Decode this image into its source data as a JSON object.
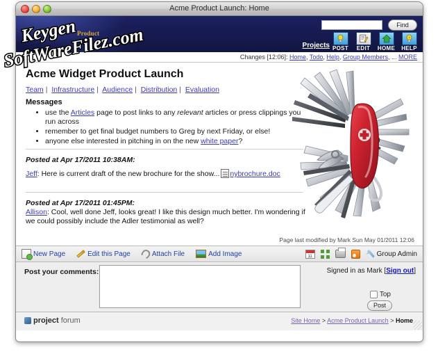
{
  "window": {
    "title": "Acme Product Launch: Home",
    "buttons": {
      "close": "close",
      "minimize": "minimize",
      "zoom": "zoom"
    }
  },
  "watermark": {
    "line1": "Keygen",
    "line2": "SoftWareFilez.com"
  },
  "header": {
    "logo_word": "Product",
    "search_value": "",
    "search_placeholder": "",
    "find_label": "Find",
    "projects_label": "Projects",
    "icons": [
      {
        "name": "post-icon",
        "label": "POST",
        "glyph": "⚈"
      },
      {
        "name": "edit-icon",
        "label": "EDIT",
        "glyph": "✎"
      },
      {
        "name": "home-icon",
        "label": "HOME",
        "glyph": "⌂"
      },
      {
        "name": "help-icon",
        "label": "HELP",
        "glyph": "?"
      }
    ]
  },
  "changes": {
    "prefix": "Changes [12:06]:",
    "links": [
      "Home",
      "Todo",
      "Help",
      "Group Members"
    ],
    "ellipsis": "...",
    "more": "MORE"
  },
  "page": {
    "title": "Acme Widget Product Launch",
    "nav": [
      "Team",
      "Infrastructure",
      "Audience",
      "Distribution",
      "Evaluation"
    ],
    "messages_heading": "Messages",
    "messages": [
      {
        "pre": "use the ",
        "link": "Articles",
        "mid": " page to post links to any ",
        "em": "relevant",
        "post": " articles or press clippings you run across"
      },
      {
        "pre": "remember to get final budget numbers to Greg by next Friday, or else!",
        "link": "",
        "mid": "",
        "em": "",
        "post": ""
      },
      {
        "pre": "anyone else interested in pitching in on the new ",
        "link": "white paper",
        "mid": "?",
        "em": "",
        "post": ""
      }
    ],
    "posts": [
      {
        "when": "Posted at Apr 17/2011 10:38AM:",
        "user": "Jeff",
        "text": ": Here is current draft of the new brochure for the show...",
        "attachment": "nybrochure.doc"
      },
      {
        "when": "Posted at Apr 17/2011 01:45PM:",
        "user": "Allison",
        "text": ": Cool, well done Jeff, looks great! I like this design much better. I'm wondering if we could possibly include the Adler testimonial as well?",
        "attachment": ""
      }
    ],
    "last_modified": "Page last modified by Mark Sun May 01/2011 12:06"
  },
  "toolbar": {
    "items": [
      {
        "name": "new-page",
        "label": "New Page"
      },
      {
        "name": "edit-this-page",
        "label": "Edit this Page"
      },
      {
        "name": "attach-file",
        "label": "Attach File"
      },
      {
        "name": "add-image",
        "label": "Add Image"
      }
    ],
    "right_icons": [
      "calendar-icon",
      "sitemap-icon",
      "print-icon",
      "rss-icon",
      "wrench-icon"
    ],
    "group_admin_label": "Group Admin"
  },
  "comments": {
    "label": "Post your comments:",
    "value": "",
    "placeholder": "",
    "signed_in_prefix": "Signed in as Mark [",
    "signed_in_user": "Mark",
    "sign_out_label": "Sign out",
    "signed_in_suffix": "]",
    "top_label": "Top",
    "post_label": "Post"
  },
  "footer": {
    "logo_part1": "project",
    "logo_part2": "forum",
    "breadcrumb": [
      "Site Home",
      "Acme Product Launch",
      "Home"
    ],
    "separator": ">"
  },
  "colors": {
    "header_blue": "#181c52",
    "link_blue": "#3b3bbf",
    "toolbar_link": "#1f3fa8",
    "crumb_purple": "#7b5fb3",
    "knife_red": "#c0202a"
  }
}
